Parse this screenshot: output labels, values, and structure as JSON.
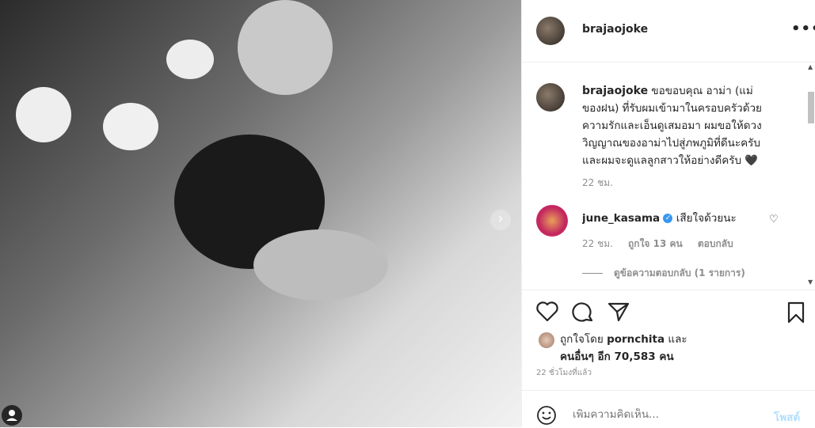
{
  "header": {
    "username": "brajaojoke",
    "more_icon": "more-horizontal-icon"
  },
  "caption": {
    "username": "brajaojoke",
    "text": "ขอขอบคุณ อาม่า (แม่ของฝน) ที่รับผมเข้ามาในครอบครัวด้วยความรักและเอ็นดูเสมอมา ผมขอให้ดวงวิญญาณของอาม่าไปสู่ภพภูมิที่ดีนะครับ และผมจะดูแลลูกสาวให้อย่างดีครับ 🖤",
    "time": "22 ชม."
  },
  "comments": [
    {
      "username": "june_kasama",
      "verified": true,
      "text": "เสียใจด้วยนะ",
      "time": "22 ชม.",
      "likes": "ถูกใจ 13 คน",
      "reply": "ตอบกลับ",
      "view_replies": "ดูข้อความตอบกลับ (1 รายการ)"
    }
  ],
  "likes": {
    "prefix": "ถูกใจโดย",
    "user": "pornchita",
    "and": "และ",
    "others": "คนอื่นๆ อีก 70,583 คน"
  },
  "timestamp": "22 ชั่วโมงที่แล้ว",
  "comment_box": {
    "placeholder": "เพิ่มความคิดเห็น...",
    "post_label": "โพสต์"
  },
  "colors": {
    "verified": "#3897f0",
    "post_disabled": "#b2dffc",
    "muted": "#8e8e8e"
  }
}
